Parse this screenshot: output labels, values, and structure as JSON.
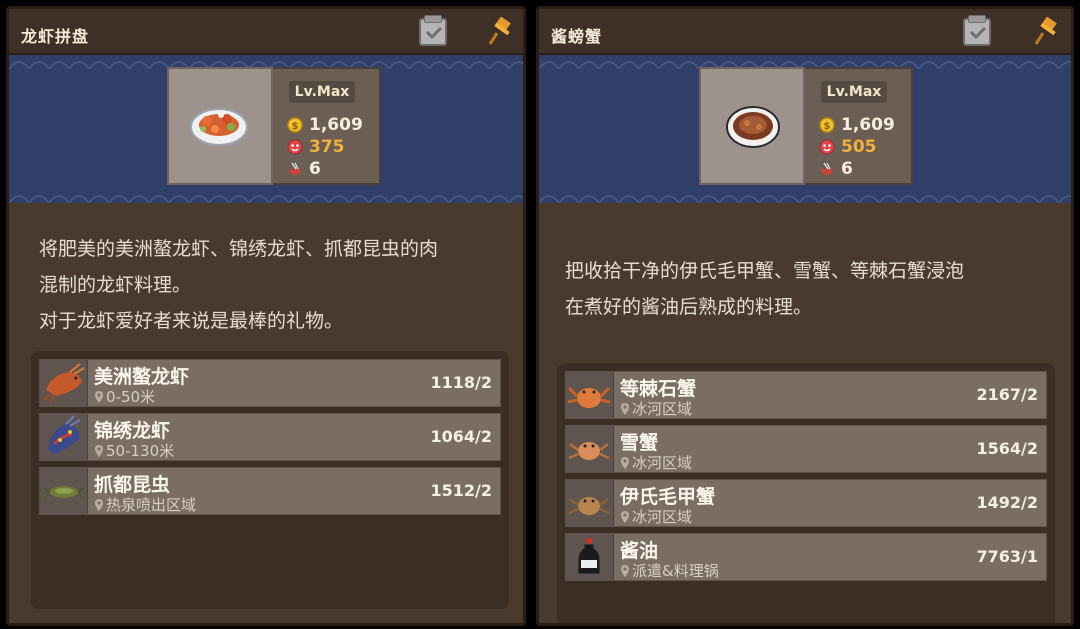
{
  "panels": [
    {
      "title": "龙虾拼盘",
      "level": "Lv.Max",
      "price": "1,609",
      "taste": "375",
      "count": "6",
      "description": [
        "将肥美的美洲螯龙虾、锦绣龙虾、抓都昆虫的肉",
        "混制的龙虾料理。",
        "对于龙虾爱好者来说是最棒的礼物。"
      ],
      "ingredients": [
        {
          "name": "美洲螯龙虾",
          "location": "0-50米",
          "qty": "1118/2",
          "icon": "lobster-icon"
        },
        {
          "name": "锦绣龙虾",
          "location": "50-130米",
          "qty": "1064/2",
          "icon": "painted-lobster-icon"
        },
        {
          "name": "抓都昆虫",
          "location": "热泉喷出区域",
          "qty": "1512/2",
          "icon": "bug-icon"
        }
      ]
    },
    {
      "title": "酱螃蟹",
      "level": "Lv.Max",
      "price": "1,609",
      "taste": "505",
      "count": "6",
      "description": [
        "把收拾干净的伊氏毛甲蟹、雪蟹、等棘石蟹浸泡",
        "在煮好的酱油后熟成的料理。"
      ],
      "ingredients": [
        {
          "name": "等棘石蟹",
          "location": "冰河区域",
          "qty": "2167/2",
          "icon": "king-crab-icon"
        },
        {
          "name": "雪蟹",
          "location": "冰河区域",
          "qty": "1564/2",
          "icon": "snow-crab-icon"
        },
        {
          "name": "伊氏毛甲蟹",
          "location": "冰河区域",
          "qty": "1492/2",
          "icon": "hairy-crab-icon"
        },
        {
          "name": "酱油",
          "location": "派遣&料理锅",
          "qty": "7763/1",
          "icon": "soy-sauce-icon"
        }
      ]
    }
  ],
  "colors": {
    "gold": "#f2c230",
    "taste": "#f2b03c",
    "banner": "#2f3f69"
  }
}
